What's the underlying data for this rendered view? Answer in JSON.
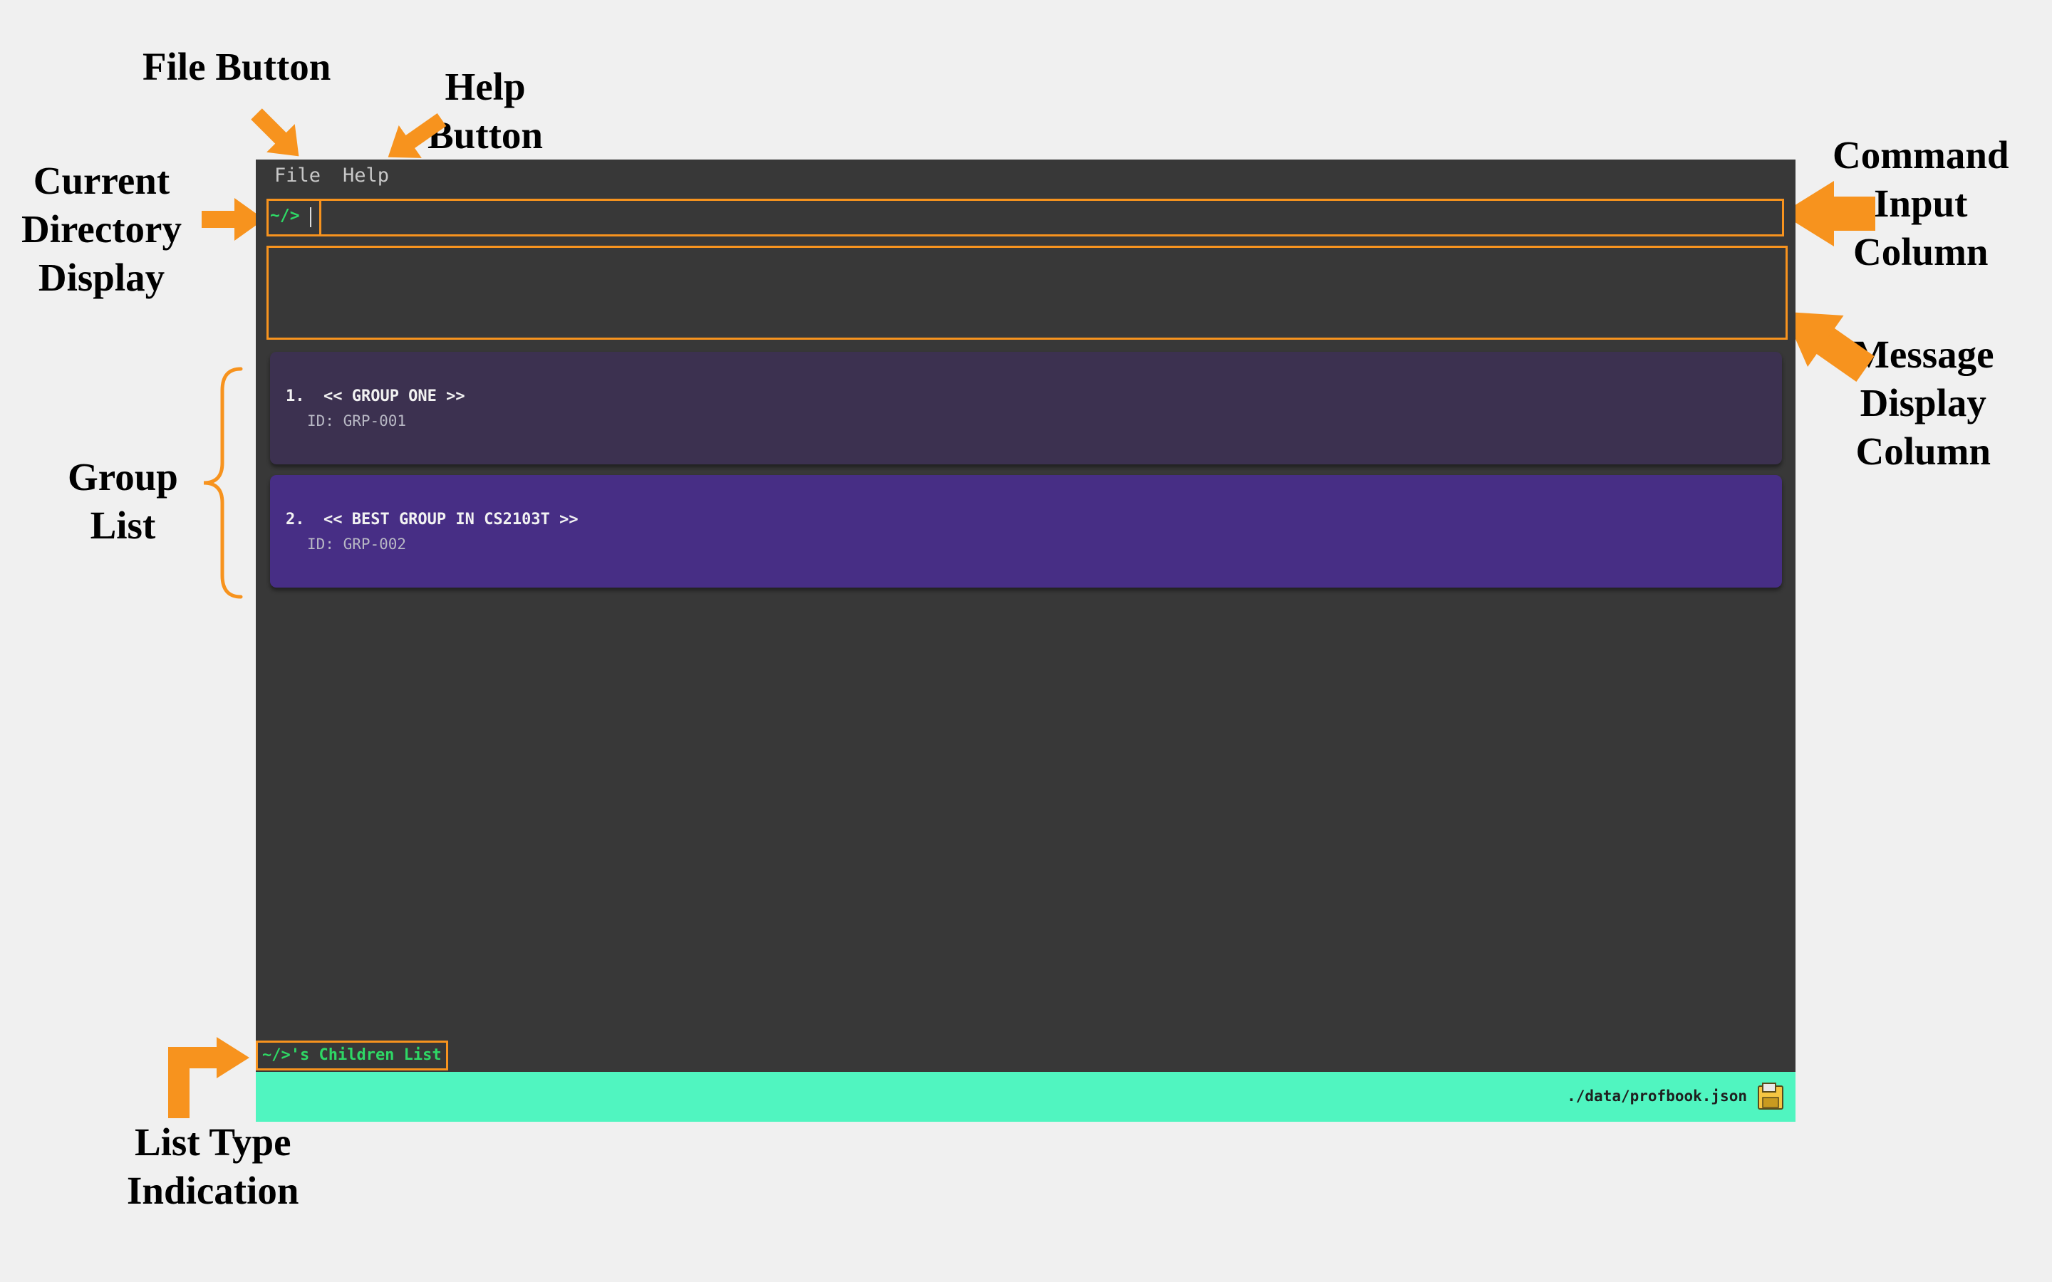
{
  "annotations": {
    "file_button": "File Button",
    "help_button": [
      "Help",
      "Button"
    ],
    "current_directory": [
      "Current",
      "Directory",
      "Display"
    ],
    "command_input": [
      "Command",
      "Input",
      "Column"
    ],
    "message_display": [
      "Message",
      "Display",
      "Column"
    ],
    "group_list": [
      "Group",
      "List"
    ],
    "list_type": [
      "List Type",
      "Indication"
    ]
  },
  "menu": {
    "file": "File",
    "help": "Help"
  },
  "command": {
    "directory": "~/>",
    "value": ""
  },
  "message": {
    "text": ""
  },
  "groups": [
    {
      "title": "1.  << GROUP ONE >>",
      "id": "ID: GRP-001",
      "color": "#3c3150"
    },
    {
      "title": "2.  << BEST GROUP IN CS2103T >>",
      "id": "ID: GRP-002",
      "color": "#472e85"
    }
  ],
  "list_type": "~/>'s Children List",
  "status": {
    "file_path": "./data/profbook.json",
    "icon": "save-file-icon"
  },
  "colors": {
    "accent": "#f7931e",
    "prompt": "#2ed865",
    "status_bar": "#50f5c0",
    "background": "#383838"
  }
}
